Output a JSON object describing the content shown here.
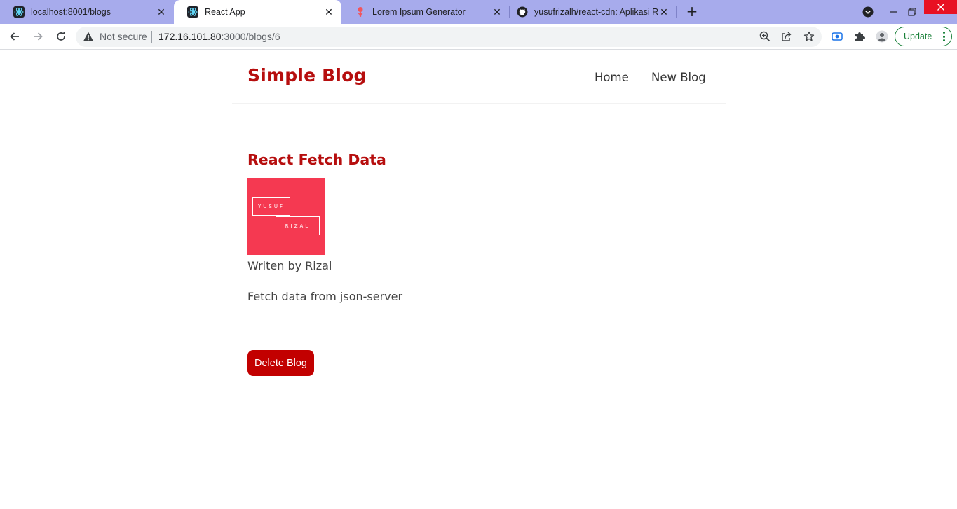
{
  "browser": {
    "tabs": [
      {
        "title": "localhost:8001/blogs",
        "icon": "react-icon",
        "active": false
      },
      {
        "title": "React App",
        "icon": "react-icon",
        "active": true
      },
      {
        "title": "Lorem Ipsum Generator",
        "icon": "lorem-ipsum-icon",
        "active": false
      },
      {
        "title": "yusufrizalh/react-cdn: Aplikasi Re",
        "icon": "github-icon",
        "active": false
      }
    ],
    "security_label": "Not secure",
    "url_host": "172.16.101.80",
    "url_rest": ":3000/blogs/6",
    "update_label": "Update",
    "tab_strip_color": "#a7abec",
    "update_color": "#188038"
  },
  "site": {
    "brand": "Simple Blog",
    "nav": {
      "home": "Home",
      "new_blog": "New Blog"
    },
    "brand_color": "#b60e0e"
  },
  "post": {
    "title": "React Fetch Data",
    "image": {
      "line1": "YUSUF",
      "line2": "RIZAL",
      "background": "#f53951"
    },
    "author": "Writen by Rizal",
    "body": "Fetch data from json-server",
    "delete_label": "Delete Blog",
    "delete_color": "#c20000"
  }
}
